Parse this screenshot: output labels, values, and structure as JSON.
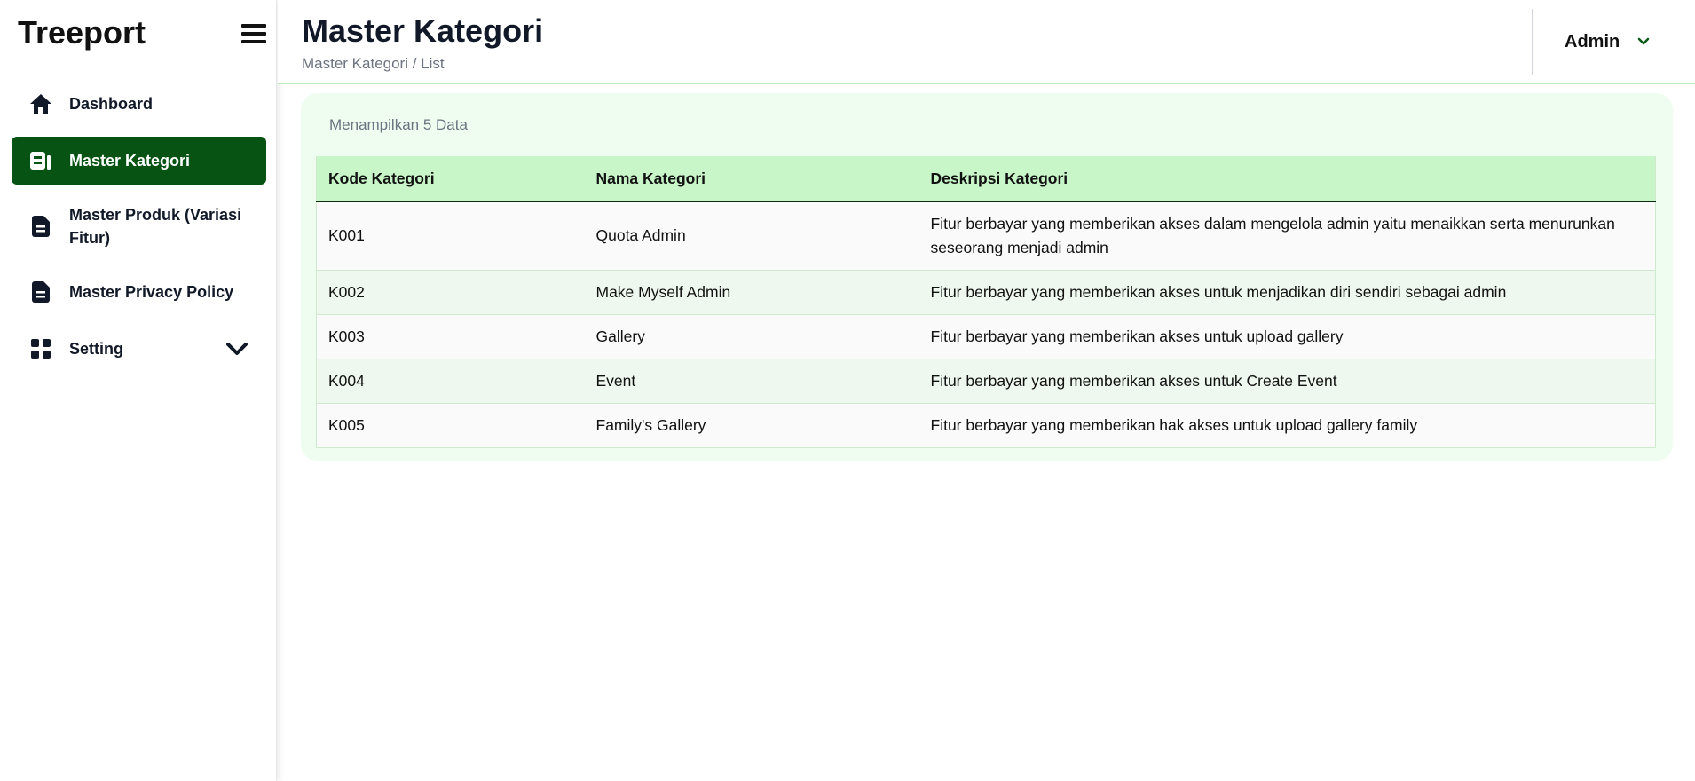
{
  "sidebar": {
    "brand": "Treeport",
    "items": [
      {
        "label": "Dashboard",
        "icon": "home-icon"
      },
      {
        "label": "Master Kategori",
        "icon": "category-icon",
        "active": true
      },
      {
        "label": "Master Produk (Variasi Fitur)",
        "icon": "document-icon"
      },
      {
        "label": "Master Privacy Policy",
        "icon": "document-icon"
      },
      {
        "label": "Setting",
        "icon": "grid-icon",
        "expandable": true
      }
    ]
  },
  "header": {
    "title": "Master Kategori",
    "breadcrumb": "Master Kategori / List",
    "user": "Admin"
  },
  "main": {
    "count_text": "Menampilkan 5 Data",
    "table": {
      "columns": [
        "Kode Kategori",
        "Nama Kategori",
        "Deskripsi Kategori"
      ],
      "rows": [
        [
          "K001",
          "Quota Admin",
          "Fitur berbayar yang memberikan akses dalam mengelola admin yaitu menaikkan serta menurunkan seseorang menjadi admin"
        ],
        [
          "K002",
          "Make Myself Admin",
          "Fitur berbayar yang memberikan akses untuk menjadikan diri sendiri sebagai admin"
        ],
        [
          "K003",
          "Gallery",
          "Fitur berbayar yang memberikan akses untuk upload gallery"
        ],
        [
          "K004",
          "Event",
          "Fitur berbayar yang memberikan akses untuk Create Event"
        ],
        [
          "K005",
          "Family's Gallery",
          "Fitur berbayar yang memberikan hak akses untuk upload gallery family"
        ]
      ]
    }
  },
  "colors": {
    "accent": "#065314",
    "card_bg": "#effdf0",
    "table_header_bg": "#c8f6c8"
  }
}
